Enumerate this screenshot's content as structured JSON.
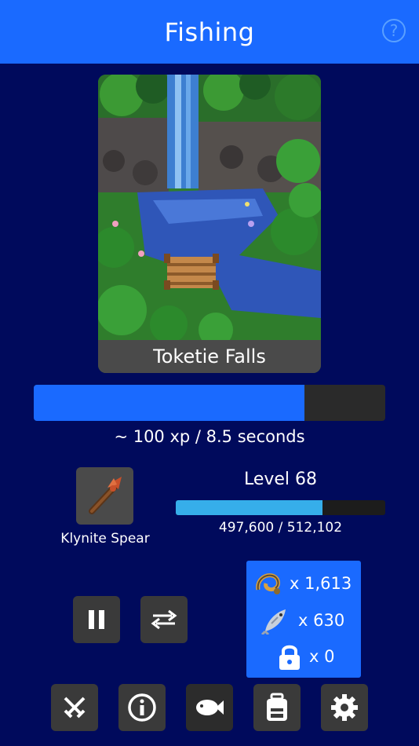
{
  "header": {
    "title": "Fishing",
    "help_icon": "help-circle-icon",
    "help_glyph": "?"
  },
  "location": {
    "name": "Toketie Falls"
  },
  "action_progress": {
    "fraction": 0.77
  },
  "rate": {
    "text": "~ 100 xp / 8.5 seconds"
  },
  "tool": {
    "name": "Klynite Spear",
    "icon": "spear-icon"
  },
  "level": {
    "label": "Level 68",
    "xp_text": "497,600 / 512,102",
    "xp_fraction": 0.7
  },
  "controls": {
    "pause": "pause-icon",
    "swap": "swap-arrows-icon"
  },
  "inventory": [
    {
      "icon": "bait-icon",
      "count": "x 1,613"
    },
    {
      "icon": "fish-icon",
      "count": "x 630"
    },
    {
      "icon": "lock-icon",
      "count": "x 0"
    }
  ],
  "nav": [
    "combat-icon",
    "info-icon",
    "fishing-icon",
    "backpack-icon",
    "settings-icon"
  ],
  "colors": {
    "header": "#1a6aff",
    "background": "#000a5c",
    "progress": "#1a6aff",
    "xp": "#36aeea"
  }
}
